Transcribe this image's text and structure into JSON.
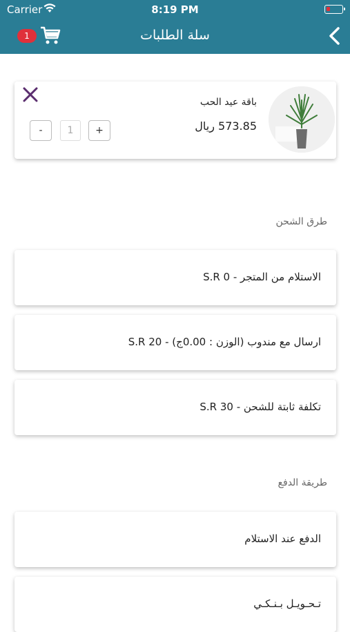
{
  "status_bar": {
    "carrier": "Carrier",
    "time": "8:19 PM"
  },
  "header": {
    "title": "سلة الطلبات",
    "cart_count": "1"
  },
  "cart": {
    "items": [
      {
        "name": "باقة عيد الحب",
        "price": "573.85 ريال",
        "quantity": "1"
      }
    ],
    "minus_label": "-",
    "plus_label": "+"
  },
  "shipping": {
    "label": "طرق الشحن",
    "options": [
      "الاستلام من المتجر - S.R 0",
      "ارسال مع مندوب (الوزن : 0.00ج) - S.R 20",
      "تكلفة ثابتة للشحن - S.R 30"
    ]
  },
  "payment": {
    "label": "طريقة الدفع",
    "options": [
      "الدفع عند الاستلام",
      "تـحـويـل بـنـكـي"
    ]
  },
  "colors": {
    "header": "#2a7d95",
    "badge": "#e0303a",
    "remove_icon": "#5a2d6e"
  }
}
